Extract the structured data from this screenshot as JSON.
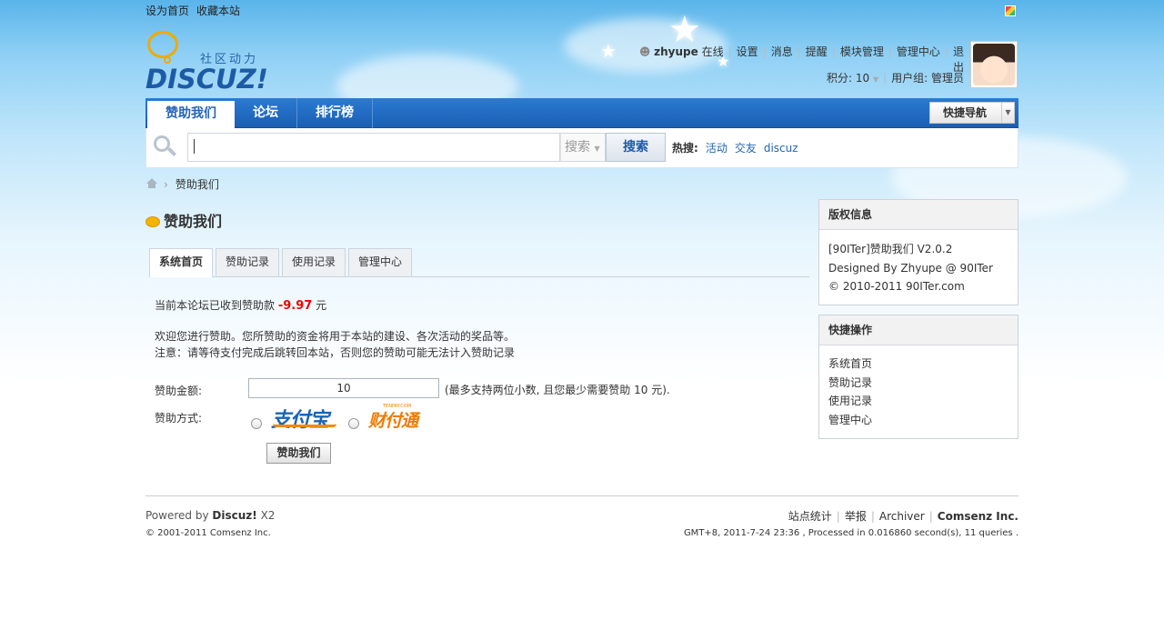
{
  "topbar": {
    "set_home": "设为首页",
    "bookmark": "收藏本站"
  },
  "logo": {
    "subtitle": "社区动力",
    "name": "DISCUZ!"
  },
  "user": {
    "name": "zhyupe",
    "status": "在线",
    "links": [
      "设置",
      "消息",
      "提醒",
      "模块管理",
      "管理中心",
      "退出"
    ],
    "points": "积分: 10",
    "group": "用户组: 管理员"
  },
  "nav": {
    "items": [
      "赞助我们",
      "论坛",
      "排行榜"
    ],
    "quick_nav": "快捷导航"
  },
  "search": {
    "value": "",
    "type": "搜索",
    "button": "搜索",
    "hot_label": "热搜:",
    "hot": [
      "活动",
      "交友",
      "discuz"
    ]
  },
  "breadcrumb": {
    "current": "赞助我们"
  },
  "page": {
    "title": "赞助我们",
    "tabs": [
      "系统首页",
      "赞助记录",
      "使用记录",
      "管理中心"
    ],
    "received_text": "当前本论坛已收到赞助款",
    "received_amount": "-9.97",
    "currency": "元",
    "welcome": "欢迎您进行赞助。您所赞助的资金将用于本站的建设、各次活动的奖品等。",
    "notice": "注意：请等待支付完成后跳转回本站，否则您的赞助可能无法计入赞助记录",
    "amount_label": "赞助金额:",
    "amount_value": "10",
    "amount_hint": "(最多支持两位小数, 且您最少需要赞助 10 元).",
    "method_label": "赞助方式:",
    "alipay": "支付宝",
    "tenpay": "财付通",
    "tenpay_sub": "TENPAY.COM",
    "submit": "赞助我们"
  },
  "sidebar": {
    "copyright": {
      "title": "版权信息",
      "lines": [
        "[90ITer]赞助我们 V2.0.2",
        "Designed By Zhyupe @ 90ITer",
        "© 2010-2011 90ITer.com"
      ]
    },
    "quick": {
      "title": "快捷操作",
      "links": [
        "系统首页",
        "赞助记录",
        "使用记录",
        "管理中心"
      ]
    }
  },
  "footer": {
    "powered": "Powered by",
    "brand": "Discuz!",
    "version": "X2",
    "copyright": "© 2001-2011 Comsenz Inc.",
    "links": [
      "站点统计",
      "举报",
      "Archiver"
    ],
    "company": "Comsenz Inc.",
    "gmt": "GMT+8, 2011-7-24 23:36 , Processed in 0.016860 second(s), 11 queries ."
  }
}
